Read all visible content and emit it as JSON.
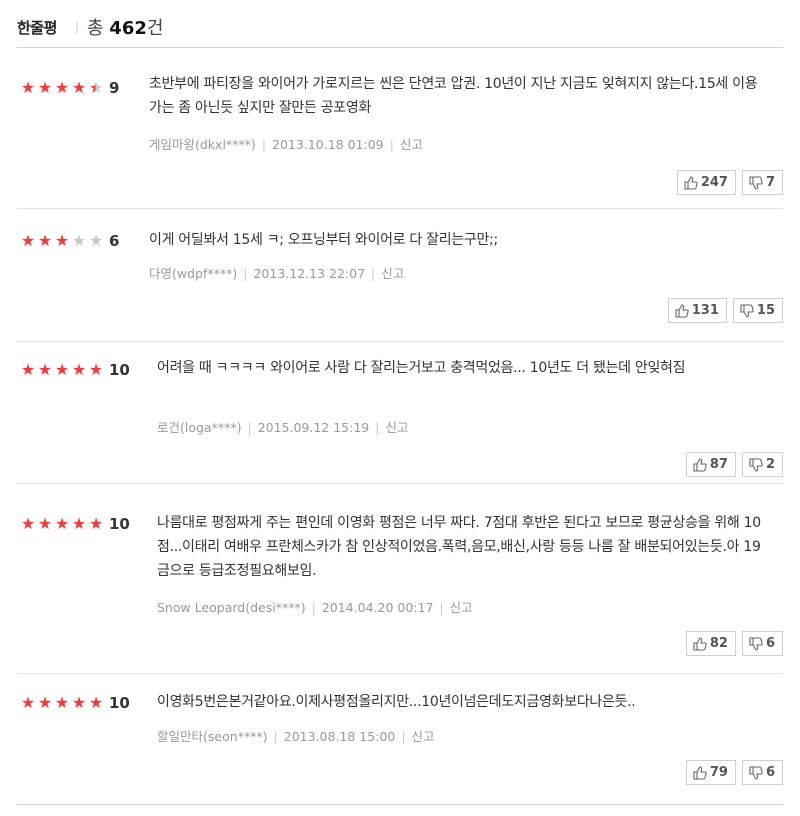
{
  "header": {
    "title": "한줄평",
    "total_prefix": "총",
    "total_count": "462",
    "total_suffix": "건"
  },
  "reviews": [
    {
      "rating": 4.5,
      "score": "9",
      "text": "초반부에 파티장을 와이어가 가로지르는 씬은 단연코 압권. 10년이 지난 지금도 잊혀지지 않는다.15세 이용가는 좀 아닌듯 싶지만 잘만든 공포영화",
      "author": "게임마왕(dkxl****)",
      "date": "2013.10.18 01:09",
      "report": "신고",
      "likes": "247",
      "dislikes": "7"
    },
    {
      "rating": 3,
      "score": "6",
      "text": "이게 어딜봐서 15세 ㅋ; 오프닝부터 와이어로 다 잘리는구만;;",
      "author": "다영(wdpf****)",
      "date": "2013.12.13 22:07",
      "report": "신고",
      "likes": "131",
      "dislikes": "15"
    },
    {
      "rating": 5,
      "score": "10",
      "text": "어려을 때 ㅋㅋㅋㅋ 와이어로 사람 다 잘리는거보고 충격먹었음... 10년도 더 됐는데 안잊혀짐",
      "author": "로건(loga****)",
      "date": "2015.09.12 15:19",
      "report": "신고",
      "likes": "87",
      "dislikes": "2"
    },
    {
      "rating": 5,
      "score": "10",
      "text": "나름대로 평점짜게 주는 편인데 이영화 평점은 너무 짜다. 7점대 후반은 된다고 보므로 평균상승을 위해 10점...이태리 여배우 프란체스카가 참 인상적이었음.폭력,음모,배신,사랑 등등 나름 잘 배분되어있는듯.아 19금으로 등급조정필요해보임.",
      "author": "Snow Leopard(desi****)",
      "date": "2014.04.20 00:17",
      "report": "신고",
      "likes": "82",
      "dislikes": "6"
    },
    {
      "rating": 5,
      "score": "10",
      "text": "이영화5번은본거같아요.이제사평점올리지만...10년이넘은데도지금영화보다나은듯..",
      "author": "할일만타(seon****)",
      "date": "2013.08.18 15:00",
      "report": "신고",
      "likes": "79",
      "dislikes": "6"
    }
  ]
}
